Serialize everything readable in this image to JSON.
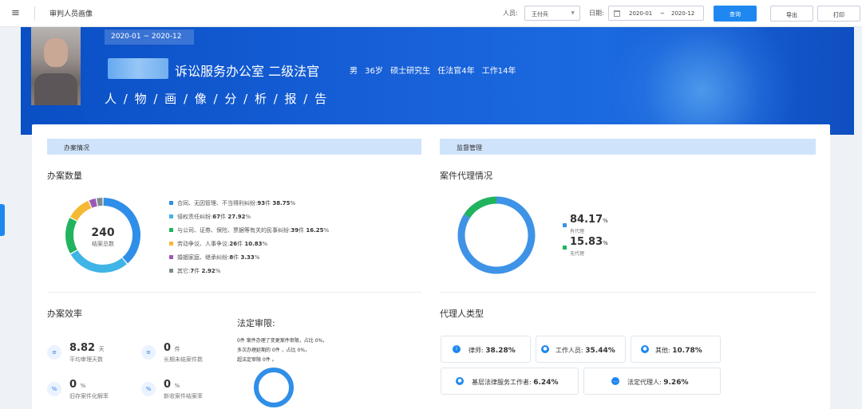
{
  "topbar": {
    "menu_icon": "≡",
    "title": "审判人员画像",
    "person_label": "人员:",
    "person_value": "王付兵",
    "date_label": "日期:",
    "date_start": "2020-01",
    "date_sep": "~",
    "date_end": "2020-12",
    "query": "查询",
    "export": "导出",
    "print": "打印"
  },
  "banner": {
    "period": "2020-01 ~ 2020-12",
    "dept_rank": "诉讼服务办公室  二级法官",
    "details": "男 36岁 硕士研究生 任法官4年 工作14年",
    "report": "人 / 物 / 画 / 像 / 分 / 析 / 报 / 告"
  },
  "cases": {
    "section": "办案情况",
    "count_title": "办案数量",
    "total": "240",
    "total_label": "结案总数",
    "legend": [
      {
        "label": "合同、无因管理、不当得利纠纷:",
        "count": "93",
        "pct": "38.75",
        "color": "#2f8fe8"
      },
      {
        "label": "侵权责任纠纷:",
        "count": "67",
        "pct": "27.92",
        "color": "#3fb4e6"
      },
      {
        "label": "与公司、证券、保险、票据等有关的民事纠纷:",
        "count": "39",
        "pct": "16.25",
        "color": "#22b35e"
      },
      {
        "label": "劳动争议、人事争议:",
        "count": "26",
        "pct": "10.83",
        "color": "#f5b936"
      },
      {
        "label": "婚姻家庭、继承纠纷:",
        "count": "8",
        "pct": "3.33",
        "color": "#9b59b6"
      },
      {
        "label": "其它:",
        "count": "7",
        "pct": "2.92",
        "color": "#7f8c8d"
      }
    ],
    "unit_jian": "件",
    "unit_pct": "%"
  },
  "efficiency": {
    "title": "办案效率",
    "items": [
      {
        "value": "8.82",
        "unit": "天",
        "desc": "平均审理天数",
        "icon": "≡"
      },
      {
        "value": "0",
        "unit": "件",
        "desc": "长期未结案件数",
        "icon": "≡"
      },
      {
        "value": "0",
        "unit": "%",
        "desc": "旧存案件化解率",
        "icon": "%"
      },
      {
        "value": "0",
        "unit": "%",
        "desc": "新收案件结案率",
        "icon": "%"
      }
    ]
  },
  "legal_limit": {
    "title": "法定审限:",
    "line1": "0件 案件办理了变更案件审限，占比 0%，",
    "line2": "多次办理延期的 0件 ，占比 0%，",
    "line3": "超法定审限 0件 。"
  },
  "supervision": {
    "section": "监督管理",
    "agency_title": "案件代理情况",
    "with_agent_pct": "84.17",
    "with_agent_label": "有代理",
    "without_agent_pct": "15.83",
    "without_agent_label": "无代理",
    "agent_type_title": "代理人类型",
    "agents": [
      {
        "label": "律师:",
        "pct": "38.28%"
      },
      {
        "label": "工作人员:",
        "pct": "35.44%"
      },
      {
        "label": "其他:",
        "pct": "10.78%"
      },
      {
        "label": "基层法律服务工作者:",
        "pct": "6.24%"
      },
      {
        "label": "法定代理人:",
        "pct": "9.26%"
      }
    ]
  },
  "colors": {
    "primary": "#1e88f0",
    "banner": "#1760d8",
    "section_bg": "#cfe3fb",
    "green": "#22b35e",
    "blue": "#3e93e6"
  }
}
